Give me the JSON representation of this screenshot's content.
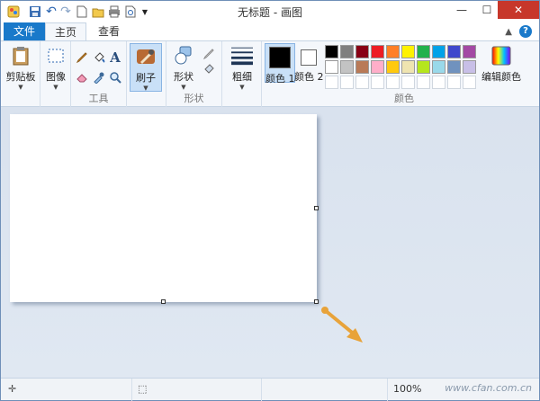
{
  "window": {
    "title": "无标题 - 画图"
  },
  "tabs": {
    "file": "文件",
    "home": "主页",
    "view": "查看"
  },
  "ribbon": {
    "clipboard": {
      "label": "剪贴板"
    },
    "image": {
      "label": "图像"
    },
    "tools": {
      "group_label": "工具"
    },
    "brush": {
      "label": "刷子"
    },
    "shapes": {
      "label": "形状",
      "group_label": "形状"
    },
    "size": {
      "label": "粗细"
    },
    "color1": {
      "label": "颜色 1",
      "value": "#000000"
    },
    "color2": {
      "label": "颜色 2",
      "value": "#ffffff"
    },
    "colors": {
      "group_label": "颜色",
      "edit_label": "编辑颜色",
      "row1": [
        "#000000",
        "#7f7f7f",
        "#880015",
        "#ed1c24",
        "#ff7f27",
        "#fff200",
        "#22b14c",
        "#00a2e8",
        "#3f48cc",
        "#a349a4"
      ],
      "row2": [
        "#ffffff",
        "#c3c3c3",
        "#b97a57",
        "#ffaec9",
        "#ffc90e",
        "#efe4b0",
        "#b5e61d",
        "#99d9ea",
        "#7092be",
        "#c8bfe7"
      ],
      "row3": [
        "#ffffff",
        "#ffffff",
        "#ffffff",
        "#ffffff",
        "#ffffff",
        "#ffffff",
        "#ffffff",
        "#ffffff",
        "#ffffff",
        "#ffffff"
      ]
    }
  },
  "status": {
    "zoom": "100%",
    "watermark": "www.cfan.com.cn"
  },
  "colors": {
    "accent": "#1979ca",
    "arrow": "#e8a33a"
  }
}
